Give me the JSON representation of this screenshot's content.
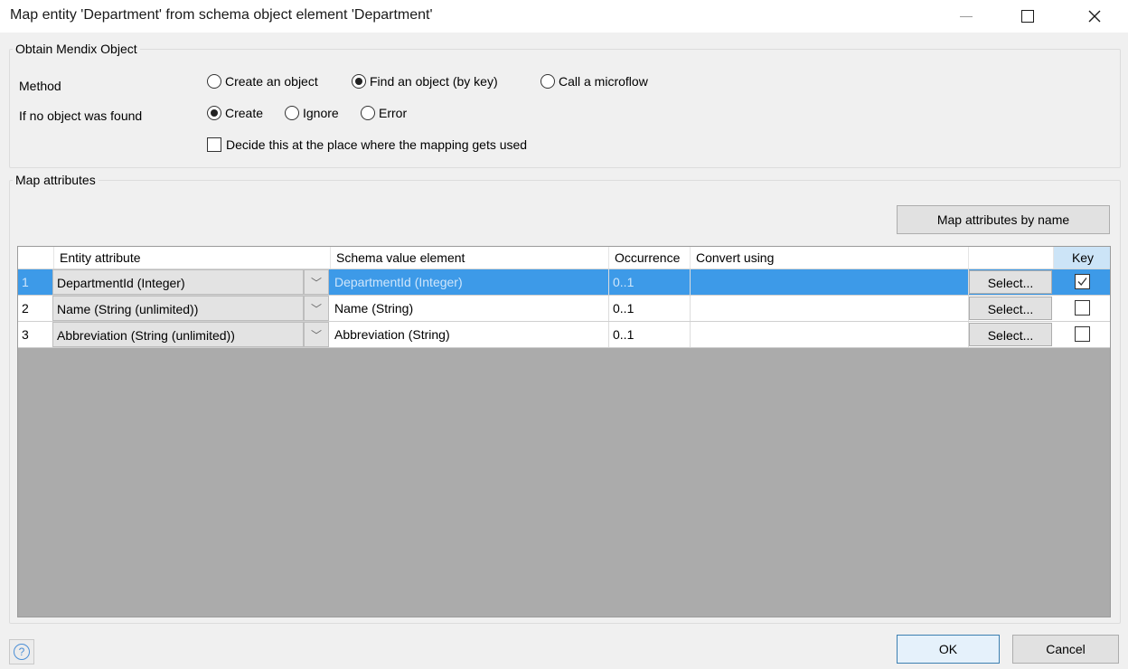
{
  "window": {
    "title": "Map entity 'Department' from schema object element 'Department'"
  },
  "obtain": {
    "legend": "Obtain Mendix Object",
    "method_label": "Method",
    "method_options": [
      "Create an object",
      "Find an object (by key)",
      "Call a microflow"
    ],
    "method_selected": "Find an object (by key)",
    "not_found_label": "If no object was found",
    "not_found_options": [
      "Create",
      "Ignore",
      "Error"
    ],
    "not_found_selected": "Create",
    "decide_label": "Decide this at the place where the mapping gets used",
    "decide_checked": false
  },
  "map": {
    "legend": "Map attributes",
    "map_by_name_label": "Map attributes by name",
    "columns": [
      "Entity attribute",
      "Schema value element",
      "Occurrence",
      "Convert using",
      "Key"
    ],
    "rows": [
      {
        "num": "1",
        "entity": "DepartmentId (Integer)",
        "schema": "DepartmentId (Integer)",
        "occurrence": "0..1",
        "convert": "",
        "select_label": "Select...",
        "key": true
      },
      {
        "num": "2",
        "entity": "Name (String (unlimited))",
        "schema": "Name (String)",
        "occurrence": "0..1",
        "convert": "",
        "select_label": "Select...",
        "key": false
      },
      {
        "num": "3",
        "entity": "Abbreviation (String (unlimited))",
        "schema": "Abbreviation (String)",
        "occurrence": "0..1",
        "convert": "",
        "select_label": "Select...",
        "key": false
      }
    ],
    "selected_row": 0
  },
  "footer": {
    "ok_label": "OK",
    "cancel_label": "Cancel",
    "help_glyph": "?"
  },
  "colors": {
    "selection": "#3d9ae8",
    "key_header": "#cce4f7",
    "grid_empty": "#ababab"
  }
}
